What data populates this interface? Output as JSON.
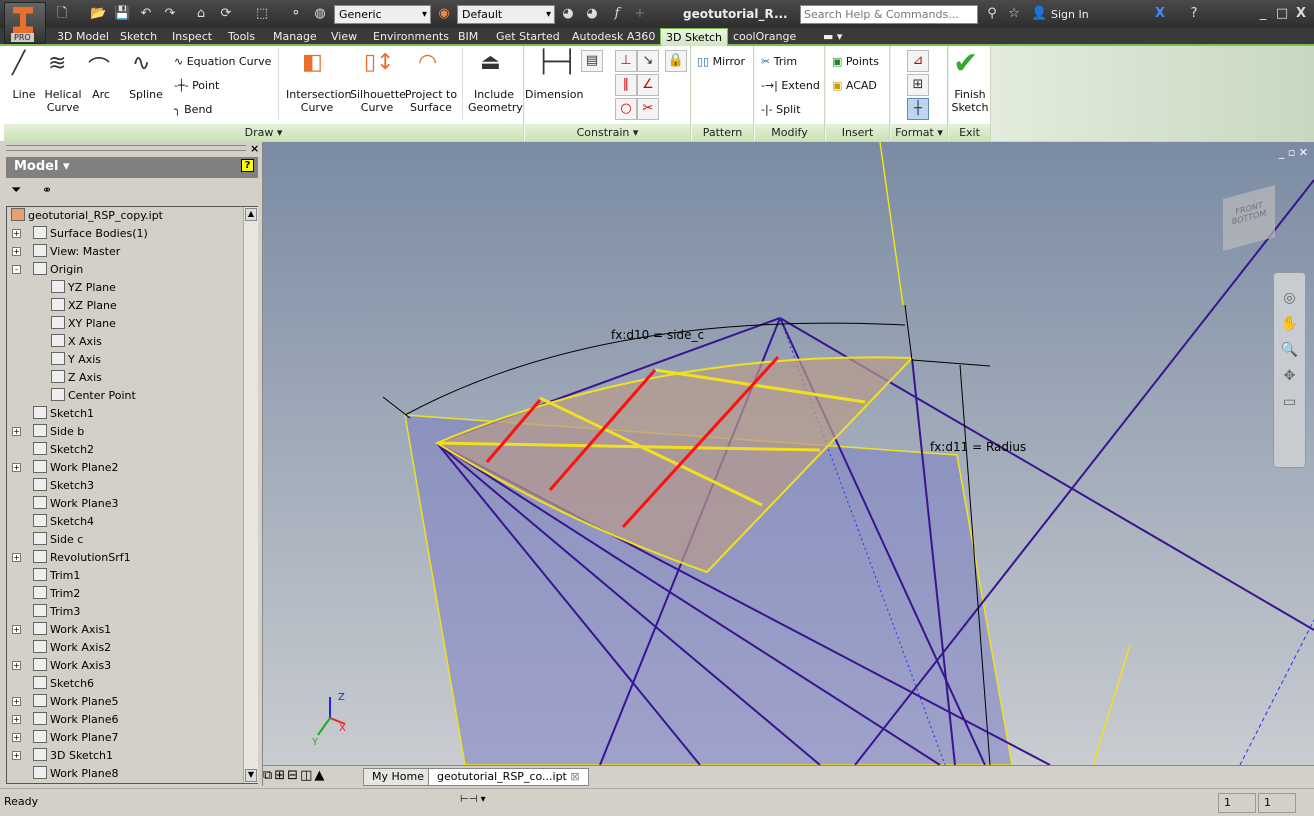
{
  "app": {
    "badge": "PRO",
    "document_title": "geotutorial_R...",
    "search_placeholder": "Search Help & Commands...",
    "sign_in": "Sign In",
    "material": "Generic",
    "appearance": "Default"
  },
  "ribbon_tabs": [
    "3D Model",
    "Sketch",
    "Inspect",
    "Tools",
    "Manage",
    "View",
    "Environments",
    "BIM",
    "Get Started",
    "Autodesk A360",
    "3D Sketch",
    "coolOrange"
  ],
  "active_tab": "3D Sketch",
  "panels": {
    "draw": {
      "label": "Draw",
      "line": "Line",
      "helical": "Helical Curve",
      "arc": "Arc",
      "spline": "Spline",
      "equation": "Equation Curve",
      "point": "Point",
      "bend": "Bend",
      "intersection": "Intersection Curve",
      "silhouette": "Silhouette Curve",
      "project": "Project to Surface",
      "include": "Include Geometry"
    },
    "constrain": {
      "label": "Constrain",
      "dimension": "Dimension"
    },
    "pattern": {
      "label": "Pattern",
      "mirror": "Mirror"
    },
    "modify": {
      "label": "Modify",
      "trim": "Trim",
      "extend": "Extend",
      "split": "Split"
    },
    "insert": {
      "label": "Insert",
      "points": "Points",
      "acad": "ACAD"
    },
    "format": {
      "label": "Format"
    },
    "exit": {
      "label": "Exit",
      "finish": "Finish Sketch"
    }
  },
  "browser": {
    "title": "Model",
    "root": "geotutorial_RSP_copy.ipt",
    "items": [
      {
        "label": "Surface Bodies(1)",
        "level": 1,
        "exp": "+"
      },
      {
        "label": "View: Master",
        "level": 1,
        "exp": "+"
      },
      {
        "label": "Origin",
        "level": 1,
        "exp": "-"
      },
      {
        "label": "YZ Plane",
        "level": 2,
        "exp": ""
      },
      {
        "label": "XZ Plane",
        "level": 2,
        "exp": ""
      },
      {
        "label": "XY Plane",
        "level": 2,
        "exp": ""
      },
      {
        "label": "X Axis",
        "level": 2,
        "exp": ""
      },
      {
        "label": "Y Axis",
        "level": 2,
        "exp": ""
      },
      {
        "label": "Z Axis",
        "level": 2,
        "exp": ""
      },
      {
        "label": "Center Point",
        "level": 2,
        "exp": ""
      },
      {
        "label": "Sketch1",
        "level": 1,
        "exp": ""
      },
      {
        "label": "Side b",
        "level": 1,
        "exp": "+"
      },
      {
        "label": "Sketch2",
        "level": 1,
        "exp": ""
      },
      {
        "label": "Work Plane2",
        "level": 1,
        "exp": "+"
      },
      {
        "label": "Sketch3",
        "level": 1,
        "exp": ""
      },
      {
        "label": "Work Plane3",
        "level": 1,
        "exp": ""
      },
      {
        "label": "Sketch4",
        "level": 1,
        "exp": ""
      },
      {
        "label": "Side c",
        "level": 1,
        "exp": ""
      },
      {
        "label": "RevolutionSrf1",
        "level": 1,
        "exp": "+"
      },
      {
        "label": "Trim1",
        "level": 1,
        "exp": ""
      },
      {
        "label": "Trim2",
        "level": 1,
        "exp": ""
      },
      {
        "label": "Trim3",
        "level": 1,
        "exp": ""
      },
      {
        "label": "Work Axis1",
        "level": 1,
        "exp": "+"
      },
      {
        "label": "Work Axis2",
        "level": 1,
        "exp": ""
      },
      {
        "label": "Work Axis3",
        "level": 1,
        "exp": "+"
      },
      {
        "label": "Sketch6",
        "level": 1,
        "exp": ""
      },
      {
        "label": "Work Plane5",
        "level": 1,
        "exp": "+"
      },
      {
        "label": "Work Plane6",
        "level": 1,
        "exp": "+"
      },
      {
        "label": "Work Plane7",
        "level": 1,
        "exp": "+"
      },
      {
        "label": "3D Sketch1",
        "level": 1,
        "exp": "+"
      },
      {
        "label": "Work Plane8",
        "level": 1,
        "exp": ""
      }
    ]
  },
  "viewport": {
    "dim1": "fx:d10 = side_c",
    "dim2": "fx:d11 = Radius",
    "viewcube_front": "FRONT",
    "viewcube_bottom": "BOTTOM",
    "axis_x": "X",
    "axis_y": "Y",
    "axis_z": "Z"
  },
  "doc_tabs": [
    "My Home",
    "geotutorial_RSP_co...ipt"
  ],
  "status": {
    "text": "Ready",
    "field1": "1",
    "field2": "1"
  }
}
